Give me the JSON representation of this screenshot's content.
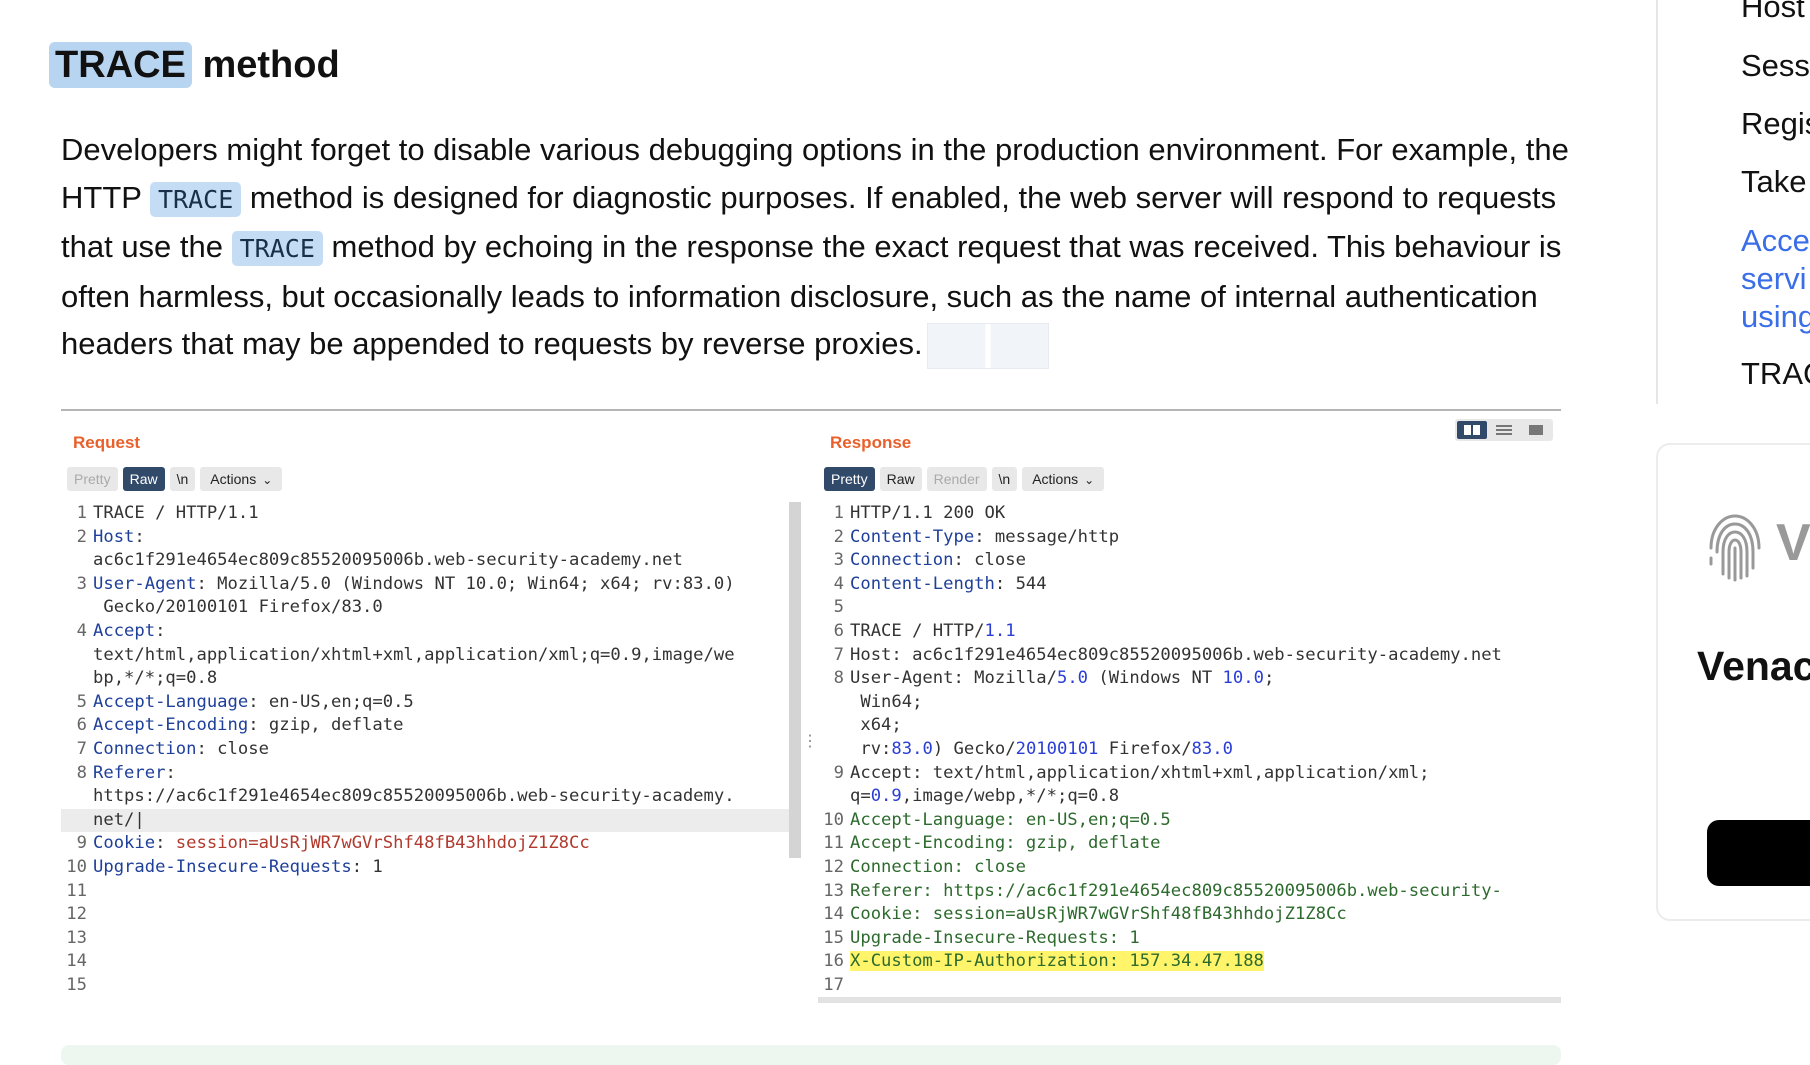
{
  "section": {
    "title_highlight": "TRACE",
    "title_rest": " method",
    "intro_part1": "Developers might forget to disable various debugging options in the production environment. For example, the HTTP ",
    "code1": "TRACE",
    "intro_part2": " method is designed for diagnostic purposes. If enabled, the web server will respond to requests that use the ",
    "code2": "TRACE",
    "intro_part3": " method by echoing in the response the exact request that was received. This behaviour is often harmless, but occasionally leads to information disclosure, such as the name of internal authentication headers that may be appended to requests by reverse proxies."
  },
  "request": {
    "title": "Request",
    "tabs": {
      "pretty": "Pretty",
      "raw": "Raw",
      "newline": "\\n",
      "actions": "Actions"
    },
    "lines": [
      {
        "n": "1",
        "k": "",
        "v": "TRACE / HTTP/1.1"
      },
      {
        "n": "2",
        "k": "Host",
        "v": ":"
      },
      {
        "n": "",
        "k": "",
        "v": "ac6c1f291e4654ec809c85520095006b.web-security-academy.net"
      },
      {
        "n": "3",
        "k": "User-Agent",
        "v": ": Mozilla/5.0 (Windows NT 10.0; Win64; x64; rv:83.0)"
      },
      {
        "n": "",
        "k": "",
        "v": " Gecko/20100101 Firefox/83.0"
      },
      {
        "n": "4",
        "k": "Accept",
        "v": ":"
      },
      {
        "n": "",
        "k": "",
        "v": "text/html,application/xhtml+xml,application/xml;q=0.9,image/we"
      },
      {
        "n": "",
        "k": "",
        "v": "bp,*/*;q=0.8"
      },
      {
        "n": "5",
        "k": "Accept-Language",
        "v": ": en-US,en;q=0.5"
      },
      {
        "n": "6",
        "k": "Accept-Encoding",
        "v": ": gzip, deflate"
      },
      {
        "n": "7",
        "k": "Connection",
        "v": ": close"
      },
      {
        "n": "8",
        "k": "Referer",
        "v": ":"
      },
      {
        "n": "",
        "k": "",
        "v": "https://ac6c1f291e4654ec809c85520095006b.web-security-academy."
      },
      {
        "n": "",
        "k": "",
        "v": "net/|"
      },
      {
        "n": "9",
        "k": "Cookie",
        "v": ": ",
        "c": "session=aUsRjWR7wGVrShf48fB43hhdojZ1Z8Cc"
      },
      {
        "n": "10",
        "k": "Upgrade-Insecure-Requests",
        "v": ": 1"
      },
      {
        "n": "11",
        "k": "",
        "v": ""
      },
      {
        "n": "12",
        "k": "",
        "v": ""
      },
      {
        "n": "13",
        "k": "",
        "v": ""
      },
      {
        "n": "14",
        "k": "",
        "v": ""
      },
      {
        "n": "15",
        "k": "",
        "v": ""
      }
    ]
  },
  "response": {
    "title": "Response",
    "tabs": {
      "pretty": "Pretty",
      "raw": "Raw",
      "render": "Render",
      "newline": "\\n",
      "actions": "Actions"
    },
    "lines": [
      {
        "n": "1",
        "t": "HTTP/1.1 200 OK"
      },
      {
        "n": "2",
        "k": "Content-Type",
        "v": ": message/http"
      },
      {
        "n": "3",
        "k": "Connection",
        "v": ": close"
      },
      {
        "n": "4",
        "k": "Content-Length",
        "v": ": 544"
      },
      {
        "n": "5",
        "t": ""
      },
      {
        "n": "6",
        "t": "TRACE / HTTP/",
        "num": "1.1"
      },
      {
        "n": "7",
        "t": "Host: ac6c1f291e4654ec809c85520095006b.web-security-academy.net"
      },
      {
        "n": "8",
        "t": "User-Agent: Mozilla/",
        "num": "5.0",
        "t2": " (Windows NT ",
        "num2": "10.0",
        "t3": ";"
      },
      {
        "n": "",
        "t": " Win64;"
      },
      {
        "n": "",
        "t": " x64;"
      },
      {
        "n": "",
        "t": " rv:",
        "num": "83.0",
        "t2": ") Gecko/",
        "num2": "20100101",
        "t3": " Firefox/",
        "num3": "83.0"
      },
      {
        "n": "9",
        "t": "Accept: text/html,application/xhtml+xml,application/xml;"
      },
      {
        "n": "",
        "t": "q=",
        "num": "0.9",
        "t2": ",image/webp,*/*;q=0.8"
      },
      {
        "n": "10",
        "g": "Accept-Language: en-US,en;q=0.5"
      },
      {
        "n": "11",
        "g": "Accept-Encoding: gzip, deflate"
      },
      {
        "n": "12",
        "g": "Connection: close"
      },
      {
        "n": "13",
        "g": "Referer: https://ac6c1f291e4654ec809c85520095006b.web-security-"
      },
      {
        "n": "14",
        "g": "Cookie: session=aUsRjWR7wGVrShf48fB43hhdojZ1Z8Cc"
      },
      {
        "n": "15",
        "g": "Upgrade-Insecure-Requests: 1"
      },
      {
        "n": "16",
        "y": "X-Custom-IP-Authorization: 157.34.47.188"
      },
      {
        "n": "17",
        "t": ""
      }
    ]
  },
  "sidebar": {
    "items": [
      "Host",
      "Sess",
      "Regis",
      "Take",
      "Acce",
      "servi",
      "using",
      "TRAC"
    ]
  },
  "ad": {
    "brand": "Venac",
    "v": "V"
  }
}
